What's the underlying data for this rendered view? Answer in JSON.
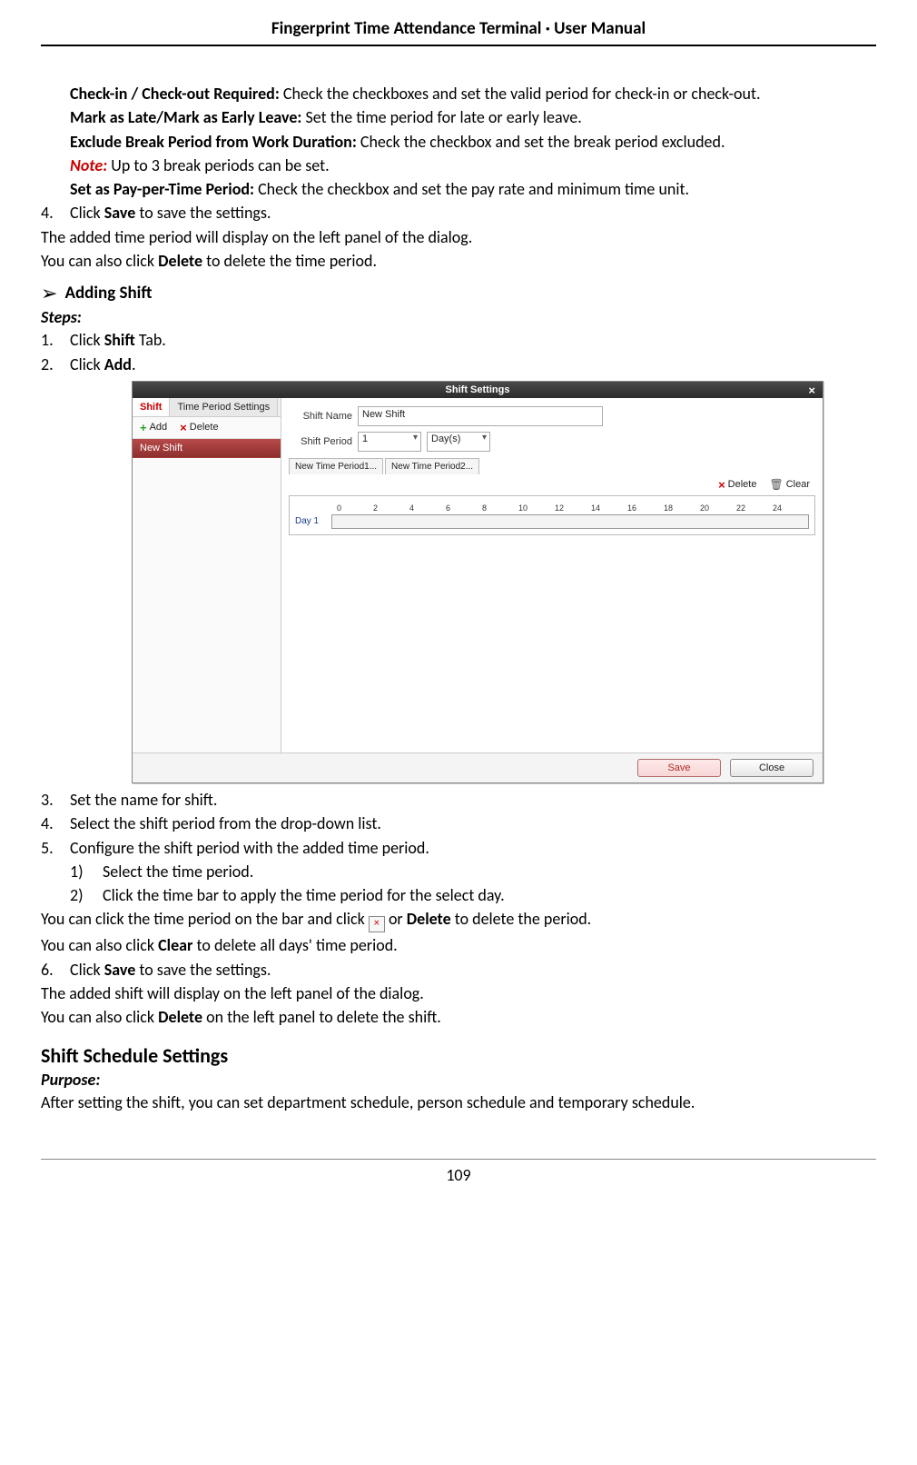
{
  "header": "Fingerprint Time Attendance Terminal · User Manual",
  "page_num": "109",
  "top": {
    "checkin_label": "Check-in / Check-out Required:",
    "checkin_text": " Check the checkboxes and set the valid period for check-in or check-out.",
    "late_label": "Mark as Late/Mark as Early Leave:",
    "late_text": " Set the time period for late or early leave.",
    "exclude_label": "Exclude Break Period from Work Duration:",
    "exclude_text": " Check the checkbox and set the break period excluded.",
    "note_label": "Note:",
    "note_text": " Up to 3 break periods can be set.",
    "pay_label": "Set as Pay-per-Time Period:",
    "pay_text": " Check the checkbox and set the pay rate and minimum time unit.",
    "step4_label": "4.",
    "step4_a": "Click ",
    "step4_b": "Save",
    "step4_c": " to save the settings.",
    "step4_line2": "The added time period will display on the left panel of the dialog.",
    "step4_line3a": "You can also click ",
    "step4_line3b": "Delete",
    "step4_line3c": " to delete the time period."
  },
  "adding_shift": {
    "title": "Adding Shift",
    "steps": "Steps:",
    "s1": {
      "n": "1.",
      "a": "Click ",
      "b": "Shift",
      "c": " Tab."
    },
    "s2": {
      "n": "2.",
      "a": "Click ",
      "b": "Add",
      "c": "."
    },
    "s3": {
      "n": "3.",
      "t": "Set the name for shift."
    },
    "s4": {
      "n": "4.",
      "t": "Select the shift period from the drop-down list."
    },
    "s5": {
      "n": "5.",
      "t": "Configure the shift period with the added time period."
    },
    "s5_1": {
      "n": "1)",
      "t": "Select the time period."
    },
    "s5_2": {
      "n": "2)",
      "t": "Click the time bar to apply the time period for the select day."
    },
    "s5_extra1a": "You can click the time period on the bar and click  ",
    "s5_extra1b": "  or ",
    "s5_extra1c": "Delete",
    "s5_extra1d": " to delete the period.",
    "s5_extra2a": "You can also click ",
    "s5_extra2b": "Clear",
    "s5_extra2c": " to delete all days' time period.",
    "s6": {
      "n": "6.",
      "a": "Click ",
      "b": "Save",
      "c": " to save the settings."
    },
    "s6_line2": "The added shift will display on the left panel of the dialog.",
    "s6_line3a": "You can also click ",
    "s6_line3b": "Delete",
    "s6_line3c": " on the left panel to delete the shift."
  },
  "schedule": {
    "title": "Shift Schedule Settings",
    "purpose": "Purpose:",
    "text": "After setting the shift, you can set department schedule, person schedule and temporary schedule."
  },
  "dialog": {
    "title": "Shift Settings",
    "tabs": {
      "shift": "Shift",
      "tp": "Time Period Settings"
    },
    "add": "Add",
    "delete": "Delete",
    "clear": "Clear",
    "list_item": "New Shift",
    "shift_name_label": "Shift Name",
    "shift_name_value": "New Shift",
    "shift_period_label": "Shift Period",
    "shift_period_value": "1",
    "shift_period_unit": "Day(s)",
    "tp1": "New Time Period1...",
    "tp2": "New Time Period2...",
    "day1": "Day 1",
    "scale": [
      "0",
      "2",
      "4",
      "6",
      "8",
      "10",
      "12",
      "14",
      "16",
      "18",
      "20",
      "22",
      "24"
    ],
    "save": "Save",
    "close": "Close"
  }
}
